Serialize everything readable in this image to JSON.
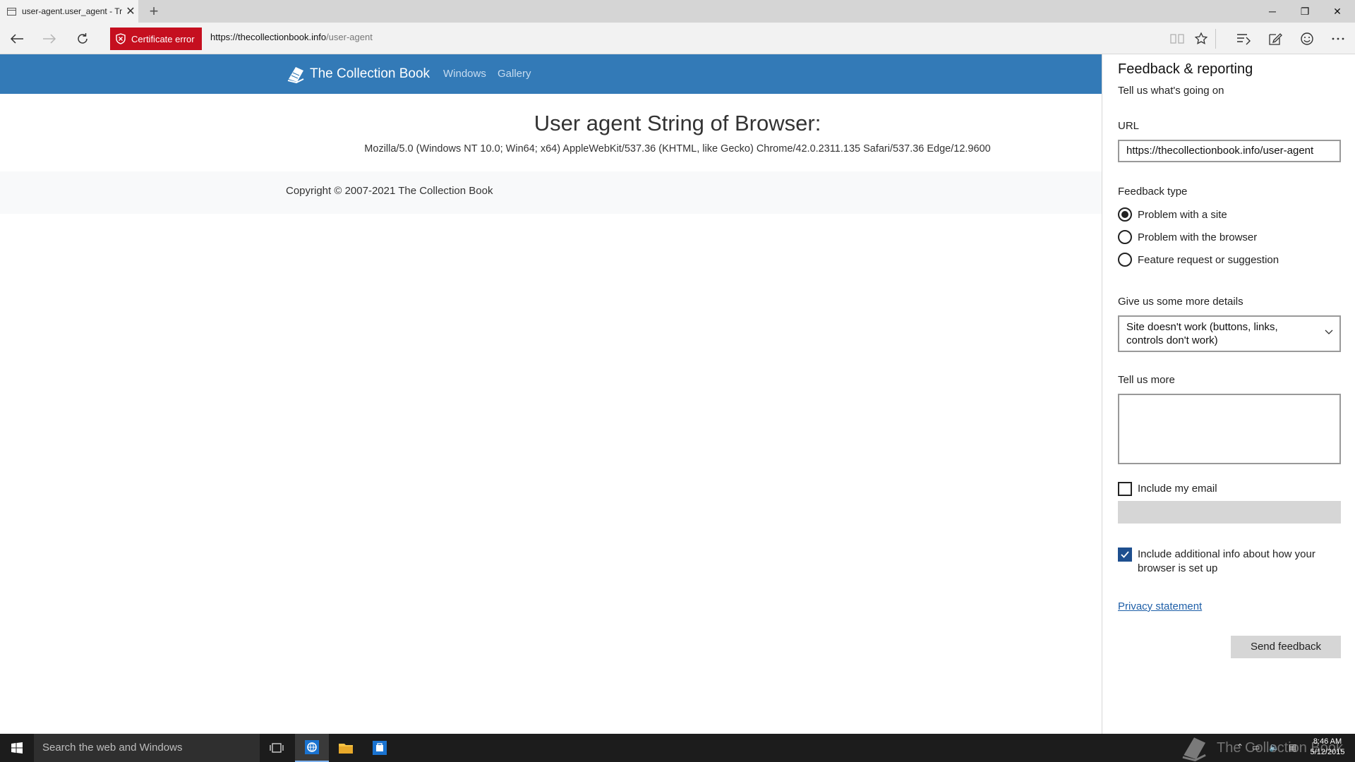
{
  "tab": {
    "title": "user-agent.user_agent - Tr",
    "close": "✕",
    "new_tab": "+"
  },
  "window_controls": {
    "minimize": "─",
    "restore": "❐",
    "close": "✕"
  },
  "address_bar": {
    "certificate_error": "Certificate error",
    "url_host": "https://thecollectionbook.info",
    "url_path": "/user-agent"
  },
  "site": {
    "brand": "The Collection Book",
    "nav": [
      "Windows",
      "Gallery"
    ],
    "ua_heading": "User agent String of Browser:",
    "ua_string": "Mozilla/5.0 (Windows NT 10.0; Win64; x64) AppleWebKit/537.36 (KHTML, like Gecko) Chrome/42.0.2311.135 Safari/537.36 Edge/12.9600",
    "copyright": "Copyright © 2007-2021 The Collection Book"
  },
  "feedback": {
    "title": "Feedback & reporting",
    "subtitle": "Tell us what's going on",
    "url_label": "URL",
    "url_value": "https://thecollectionbook.info/user-agent",
    "type_label": "Feedback type",
    "types": [
      {
        "label": "Problem with a site",
        "selected": true
      },
      {
        "label": "Problem with the browser",
        "selected": false
      },
      {
        "label": "Feature request or suggestion",
        "selected": false
      }
    ],
    "details_label": "Give us some more details",
    "details_value": "Site doesn't work (buttons, links, controls don't work)",
    "more_label": "Tell us more",
    "more_value": "",
    "include_email_label": "Include my email",
    "include_email_checked": false,
    "include_info_label": "Include additional info about how your browser is set up",
    "include_info_checked": true,
    "privacy": "Privacy statement",
    "send": "Send feedback"
  },
  "taskbar": {
    "search_placeholder": "Search the web and Windows",
    "watermark": "The Collection Book",
    "time": "8:46 AM",
    "date": "5/12/2015"
  },
  "colors": {
    "site_header": "#337ab7",
    "cert_error": "#c50f1f",
    "checkbox_checked": "#1e4f8f",
    "taskbar": "#1c1c1c"
  }
}
